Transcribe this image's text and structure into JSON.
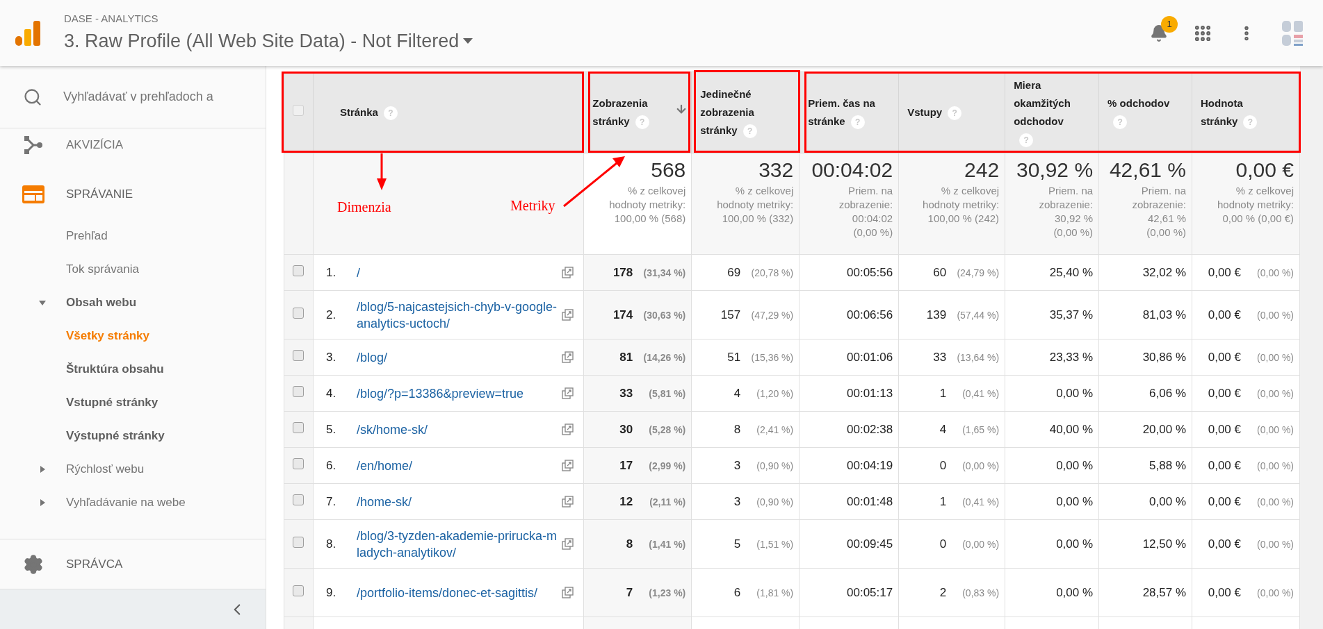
{
  "header": {
    "account": "DASE - ANALYTICS",
    "view": "3. Raw Profile (All Web Site Data) - Not Filtered",
    "notifications": "1"
  },
  "sidebar": {
    "search_placeholder": "Vyhľadávať v prehľadoch a",
    "sections": [
      {
        "kind": "acquisition",
        "label": "AKVIZÍCIA",
        "active": false
      },
      {
        "kind": "behavior",
        "label": "SPRÁVANIE",
        "active": true
      }
    ],
    "items": [
      {
        "kind": "leaf",
        "label": "Prehľad",
        "selected": false
      },
      {
        "kind": "leaf",
        "label": "Tok správania",
        "selected": false
      },
      {
        "kind": "group",
        "label": "Obsah webu",
        "expanded": true,
        "selected": false,
        "children": [
          {
            "kind": "leaf",
            "label": "Všetky stránky",
            "selected": true
          },
          {
            "kind": "leaf",
            "label": "Štruktúra obsahu",
            "selected": false
          },
          {
            "kind": "leaf",
            "label": "Vstupné stránky",
            "selected": false
          },
          {
            "kind": "leaf",
            "label": "Výstupné stránky",
            "selected": false
          }
        ]
      },
      {
        "kind": "group",
        "label": "Rýchlosť webu",
        "expanded": false,
        "selected": false
      },
      {
        "kind": "group",
        "label": "Vyhľadávanie na webe",
        "expanded": false,
        "selected": false
      }
    ],
    "admin": "SPRÁVCA"
  },
  "table": {
    "all_checked": false,
    "columns": [
      {
        "label": "Stránka",
        "help": "?",
        "sorted": false
      },
      {
        "label": "Zobrazenia stránky",
        "help": "?",
        "sorted": true
      },
      {
        "label": "Jedinečné zobrazenia stránky",
        "help": "?",
        "sorted": false
      },
      {
        "label": "Priem. čas na stránke",
        "help": "?",
        "sorted": false
      },
      {
        "label": "Vstupy",
        "help": "?",
        "sorted": false
      },
      {
        "label": "Miera okamžitých odchodov",
        "help": "?",
        "sorted": false
      },
      {
        "label": "% odchodov",
        "help": "?",
        "sorted": false
      },
      {
        "label": "Hodnota stránky",
        "help": "?",
        "sorted": false
      }
    ],
    "summary": [
      {
        "value": "568",
        "note_lines": [
          "% z celkovej",
          "hodnoty metriky:",
          "100,00 % (568)"
        ]
      },
      {
        "value": "332",
        "note_lines": [
          "% z celkovej",
          "hodnoty metriky:",
          "100,00 % (332)"
        ]
      },
      {
        "value": "00:04:02",
        "note_lines": [
          "Priem. na",
          "zobrazenie:",
          "00:04:02",
          "(0,00 %)"
        ]
      },
      {
        "value": "242",
        "note_lines": [
          "% z celkovej",
          "hodnoty metriky:",
          "100,00 % (242)"
        ]
      },
      {
        "value": "30,92 %",
        "note_lines": [
          "Priem. na",
          "zobrazenie:",
          "30,92 %",
          "(0,00 %)"
        ]
      },
      {
        "value": "42,61 %",
        "note_lines": [
          "Priem. na",
          "zobrazenie:",
          "42,61 %",
          "(0,00 %)"
        ]
      },
      {
        "value": "0,00 €",
        "note_lines": [
          "% z celkovej",
          "hodnoty metriky:",
          "0,00 % (0,00 €)"
        ]
      }
    ],
    "rows": [
      {
        "index": "1.",
        "page": "/",
        "checked": false,
        "metrics": [
          {
            "value": "178",
            "pct": "(31,34 %)"
          },
          {
            "value": "69",
            "pct": "(20,78 %)"
          },
          {
            "value": "00:05:56"
          },
          {
            "value": "60",
            "pct": "(24,79 %)"
          },
          {
            "value": "25,40 %"
          },
          {
            "value": "32,02 %"
          },
          {
            "value": "0,00 €",
            "pct": "(0,00 %)"
          }
        ]
      },
      {
        "index": "2.",
        "page": "/blog/5-najcastejsich-chyb-v-google-analytics-uctoch/",
        "checked": false,
        "metrics": [
          {
            "value": "174",
            "pct": "(30,63 %)"
          },
          {
            "value": "157",
            "pct": "(47,29 %)"
          },
          {
            "value": "00:06:56"
          },
          {
            "value": "139",
            "pct": "(57,44 %)"
          },
          {
            "value": "35,37 %"
          },
          {
            "value": "81,03 %"
          },
          {
            "value": "0,00 €",
            "pct": "(0,00 %)"
          }
        ]
      },
      {
        "index": "3.",
        "page": "/blog/",
        "checked": false,
        "metrics": [
          {
            "value": "81",
            "pct": "(14,26 %)"
          },
          {
            "value": "51",
            "pct": "(15,36 %)"
          },
          {
            "value": "00:01:06"
          },
          {
            "value": "33",
            "pct": "(13,64 %)"
          },
          {
            "value": "23,33 %"
          },
          {
            "value": "30,86 %"
          },
          {
            "value": "0,00 €",
            "pct": "(0,00 %)"
          }
        ]
      },
      {
        "index": "4.",
        "page": "/blog/?p=13386&preview=true",
        "checked": false,
        "metrics": [
          {
            "value": "33",
            "pct": "(5,81 %)"
          },
          {
            "value": "4",
            "pct": "(1,20 %)"
          },
          {
            "value": "00:01:13"
          },
          {
            "value": "1",
            "pct": "(0,41 %)"
          },
          {
            "value": "0,00 %"
          },
          {
            "value": "6,06 %"
          },
          {
            "value": "0,00 €",
            "pct": "(0,00 %)"
          }
        ]
      },
      {
        "index": "5.",
        "page": "/sk/home-sk/",
        "checked": false,
        "metrics": [
          {
            "value": "30",
            "pct": "(5,28 %)"
          },
          {
            "value": "8",
            "pct": "(2,41 %)"
          },
          {
            "value": "00:02:38"
          },
          {
            "value": "4",
            "pct": "(1,65 %)"
          },
          {
            "value": "40,00 %"
          },
          {
            "value": "20,00 %"
          },
          {
            "value": "0,00 €",
            "pct": "(0,00 %)"
          }
        ]
      },
      {
        "index": "6.",
        "page": "/en/home/",
        "checked": false,
        "metrics": [
          {
            "value": "17",
            "pct": "(2,99 %)"
          },
          {
            "value": "3",
            "pct": "(0,90 %)"
          },
          {
            "value": "00:04:19"
          },
          {
            "value": "0",
            "pct": "(0,00 %)"
          },
          {
            "value": "0,00 %"
          },
          {
            "value": "5,88 %"
          },
          {
            "value": "0,00 €",
            "pct": "(0,00 %)"
          }
        ]
      },
      {
        "index": "7.",
        "page": "/home-sk/",
        "checked": false,
        "metrics": [
          {
            "value": "12",
            "pct": "(2,11 %)"
          },
          {
            "value": "3",
            "pct": "(0,90 %)"
          },
          {
            "value": "00:01:48"
          },
          {
            "value": "1",
            "pct": "(0,41 %)"
          },
          {
            "value": "0,00 %"
          },
          {
            "value": "0,00 %"
          },
          {
            "value": "0,00 €",
            "pct": "(0,00 %)"
          }
        ]
      },
      {
        "index": "8.",
        "page": "/blog/3-tyzden-akademie-prirucka-mladych-analytikov/",
        "checked": false,
        "metrics": [
          {
            "value": "8",
            "pct": "(1,41 %)"
          },
          {
            "value": "5",
            "pct": "(1,51 %)"
          },
          {
            "value": "00:09:45"
          },
          {
            "value": "0",
            "pct": "(0,00 %)"
          },
          {
            "value": "0,00 %"
          },
          {
            "value": "12,50 %"
          },
          {
            "value": "0,00 €",
            "pct": "(0,00 %)"
          }
        ]
      },
      {
        "index": "9.",
        "page": "/portfolio-items/donec-et-sagittis/",
        "checked": false,
        "metrics": [
          {
            "value": "7",
            "pct": "(1,23 %)"
          },
          {
            "value": "6",
            "pct": "(1,81 %)"
          },
          {
            "value": "00:05:17"
          },
          {
            "value": "2",
            "pct": "(0,83 %)"
          },
          {
            "value": "0,00 %"
          },
          {
            "value": "28,57 %"
          },
          {
            "value": "0,00 €",
            "pct": "(0,00 %)"
          }
        ]
      }
    ]
  },
  "annotations": [
    {
      "text": "Dimenzia"
    },
    {
      "text": "Metriky"
    }
  ]
}
